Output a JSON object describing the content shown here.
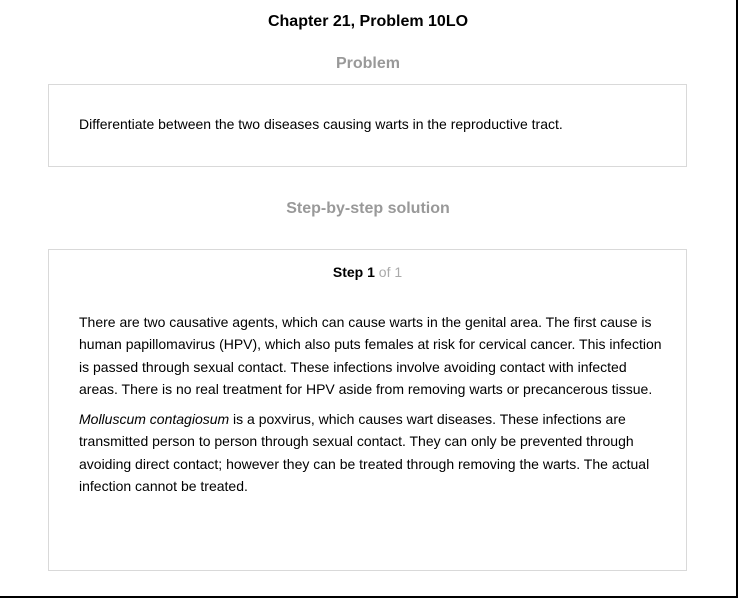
{
  "page": {
    "title": "Chapter 21, Problem 10LO"
  },
  "problem": {
    "heading": "Problem",
    "text": "Differentiate between the two diseases causing warts in the reproductive tract."
  },
  "solution": {
    "heading": "Step-by-step solution",
    "step": {
      "label": "Step",
      "number": "1",
      "of_text": "of 1"
    },
    "paragraphs": {
      "p1": "There are two causative agents, which can cause warts in the genital area. The first cause is human papillomavirus (HPV), which also puts females at risk for cervical cancer. This infection is passed through sexual contact. These infections involve avoiding contact with infected areas. There is no real treatment for HPV aside from removing warts or precancerous tissue.",
      "p2_italic": "Molluscum contagiosum",
      "p2_rest": " is a poxvirus, which causes wart diseases. These infections are transmitted person to person through sexual contact. They can only be prevented through avoiding direct contact; however they can be treated through removing the warts. The actual infection cannot be treated."
    }
  }
}
